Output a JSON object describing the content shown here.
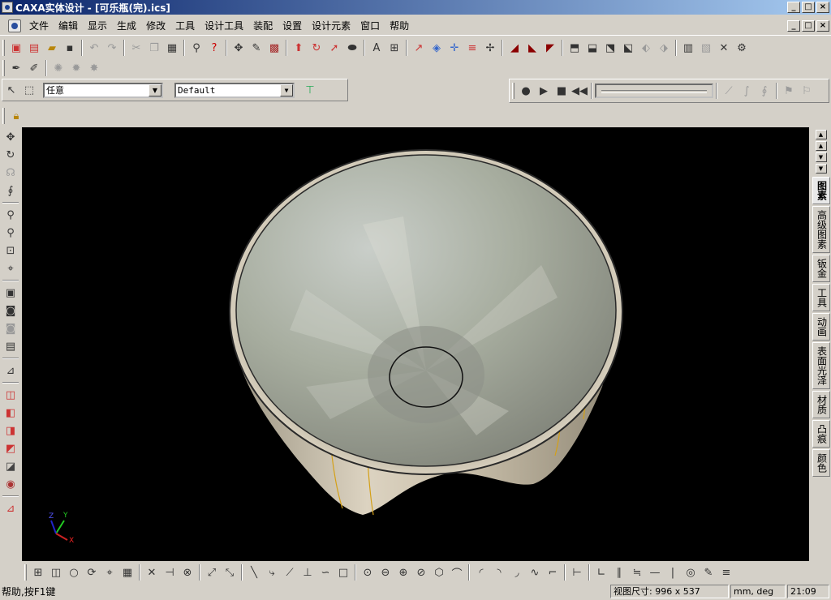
{
  "window": {
    "title": "CAXA实体设计 - [可乐瓶(完).ics]",
    "caption_buttons": [
      "_",
      "□",
      "×"
    ]
  },
  "menu": {
    "items": [
      "文件",
      "编辑",
      "显示",
      "生成",
      "修改",
      "工具",
      "设计工具",
      "装配",
      "设置",
      "设计元素",
      "窗口",
      "帮助"
    ]
  },
  "selection_toolbar": {
    "filter_value": "任意",
    "config_value": "Default"
  },
  "right_tabs": [
    "图素",
    "高级图素",
    "钣金",
    "工具",
    "动画",
    "表面光泽",
    "材质",
    "凸痕",
    "颜色"
  ],
  "axis_triad": {
    "x_label": "X",
    "y_label": "Y",
    "z_label": "Z"
  },
  "status": {
    "message": "帮助,按F1键",
    "view_size": "视图尺寸: 996 x 537",
    "units": "mm, deg",
    "time": "21:09"
  },
  "colors": {
    "titlebar_start": "#0a246a",
    "titlebar_end": "#a6caf0",
    "viewport_bg": "#000000",
    "chrome": "#d4d0c8"
  }
}
